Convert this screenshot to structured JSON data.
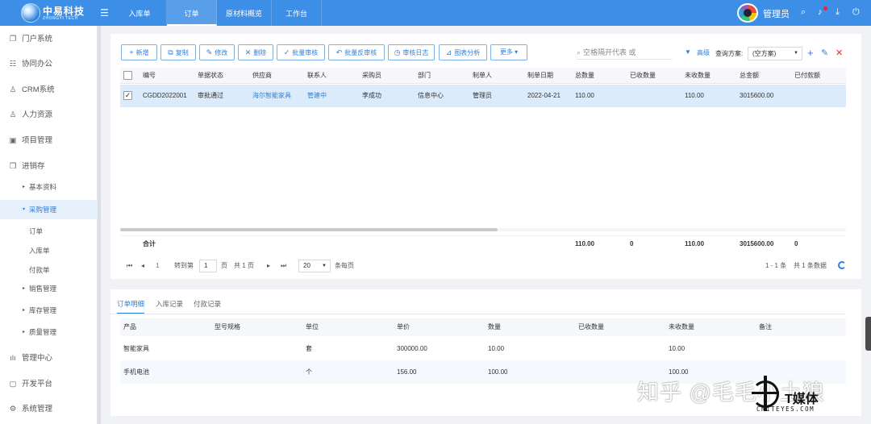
{
  "brand": {
    "name_cn": "中易科技",
    "name_en": "ZHONGYI TECH"
  },
  "nav_tabs": [
    "入库单",
    "订单",
    "原材料概览",
    "工作台"
  ],
  "active_tab": "订单",
  "user": {
    "name": "管理员"
  },
  "sidebar": {
    "items": [
      {
        "icon": "❐",
        "label": "门户系统"
      },
      {
        "icon": "☷",
        "label": "协同办公"
      },
      {
        "icon": "♙",
        "label": "CRM系统"
      },
      {
        "icon": "♙",
        "label": "人力资源"
      },
      {
        "icon": "▣",
        "label": "项目管理"
      },
      {
        "icon": "❒",
        "label": "进销存"
      }
    ],
    "sub": [
      {
        "label": "基本资料",
        "arrow": "▸"
      },
      {
        "label": "采购管理",
        "arrow": "▾"
      }
    ],
    "leaves": [
      "订单",
      "入库单",
      "付款单"
    ],
    "sub2": [
      {
        "label": "销售管理",
        "arrow": "▸"
      },
      {
        "label": "库存管理",
        "arrow": "▸"
      },
      {
        "label": "质量管理",
        "arrow": "▸"
      }
    ],
    "bottom": [
      {
        "icon": "ılı",
        "label": "管理中心"
      },
      {
        "icon": "▢",
        "label": "开发平台"
      },
      {
        "icon": "⚙",
        "label": "系统管理"
      }
    ]
  },
  "toolbar": {
    "buttons": [
      {
        "icon": "+",
        "label": "新增"
      },
      {
        "icon": "⧉",
        "label": "复制"
      },
      {
        "icon": "✎",
        "label": "修改"
      },
      {
        "icon": "✕",
        "label": "删除"
      },
      {
        "icon": "✓",
        "label": "批量审核"
      },
      {
        "icon": "↶",
        "label": "批量反审核"
      },
      {
        "icon": "◷",
        "label": "审核日志"
      },
      {
        "icon": "⊿",
        "label": "图表分析"
      },
      {
        "icon": "",
        "label": "更多 ▾"
      }
    ],
    "search_placeholder": "空格隔开代表 或",
    "advanced": "高级",
    "scheme_label": "查询方案:",
    "scheme_value": "(空方案)"
  },
  "grid": {
    "columns": [
      "编号",
      "单据状态",
      "供应商",
      "联系人",
      "采购员",
      "部门",
      "制单人",
      "制单日期",
      "总数量",
      "已收数量",
      "未收数量",
      "总金额",
      "已付款额"
    ],
    "rows": [
      {
        "checked": "✓",
        "cells": [
          "CGDD2022001",
          "审批通过",
          "海尔智能家具",
          "管建中",
          "李成功",
          "信息中心",
          "管理员",
          "2022-04-21",
          "110.00",
          "",
          "110.00",
          "3015600.00",
          ""
        ]
      }
    ],
    "summary": {
      "label": "合计",
      "total_qty": "110.00",
      "received": "0",
      "unreceived": "110.00",
      "amount": "3015600.00",
      "paid": "0"
    }
  },
  "pager": {
    "first": "⏮",
    "prev": "◂",
    "page": "1",
    "goto_label": "转到第",
    "page_input": "1",
    "page_unit": "页",
    "total_pages": "共 1 页",
    "next": "▸",
    "last": "⏭",
    "page_size": "20",
    "per_page": "条每页",
    "range": "1 - 1 条",
    "total": "共 1 条数据"
  },
  "detail": {
    "tabs": [
      "订单明细",
      "入库记录",
      "付款记录"
    ],
    "active": "订单明细",
    "columns": [
      "产品",
      "型号规格",
      "单位",
      "单价",
      "数量",
      "已收数量",
      "未收数量",
      "备注"
    ],
    "rows": [
      [
        "智能家具",
        "",
        "套",
        "300000.00",
        "10.00",
        "",
        "10.00",
        ""
      ],
      [
        "手机电池",
        "",
        "个",
        "156.00",
        "100.00",
        "",
        "100.00",
        ""
      ]
    ]
  },
  "watermark": {
    "text": "知乎 @毛毛小土狼",
    "logo_cn": "T媒体",
    "logo_en": "CNITEYES.COM"
  }
}
